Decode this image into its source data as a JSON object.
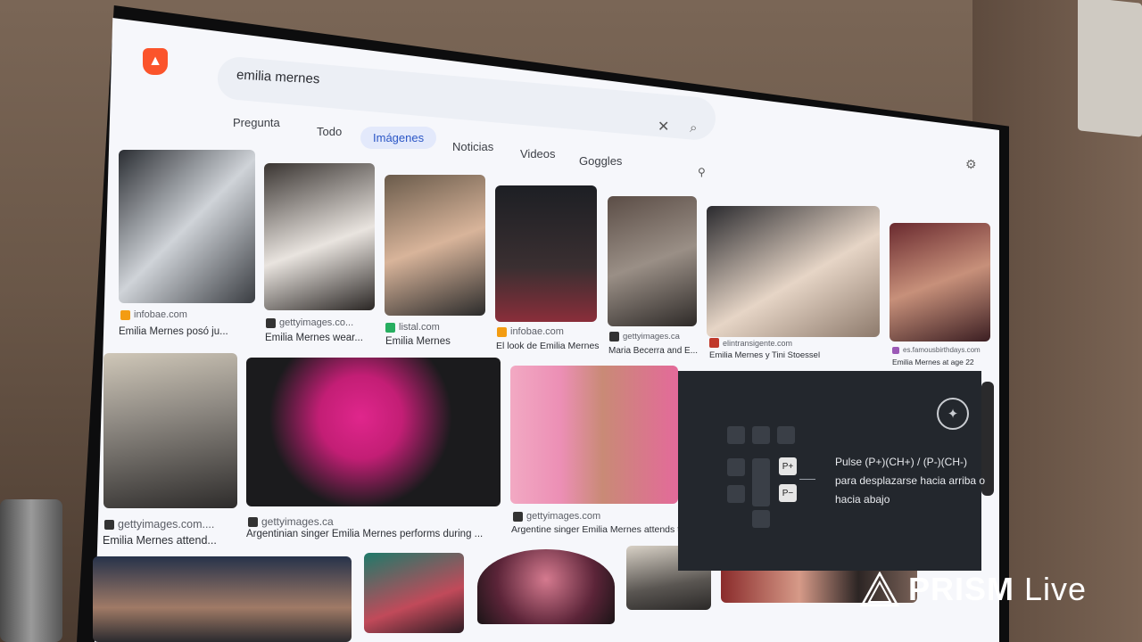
{
  "browser": {
    "search_query": "emilia mernes"
  },
  "tabs": [
    {
      "label": "Pregunta",
      "active": false
    },
    {
      "label": "Todo",
      "active": false
    },
    {
      "label": "Imágenes",
      "active": true
    },
    {
      "label": "Noticias",
      "active": false
    },
    {
      "label": "Videos",
      "active": false
    },
    {
      "label": "Goggles",
      "active": false
    }
  ],
  "results": [
    {
      "source": "infobae.com",
      "title": "Emilia Mernes posó ju...",
      "fav": "#f39c12"
    },
    {
      "source": "gettyimages.co...",
      "title": "Emilia Mernes wear...",
      "fav": "#333333"
    },
    {
      "source": "listal.com",
      "title": "Emilia Mernes",
      "fav": "#27ae60"
    },
    {
      "source": "infobae.com",
      "title": "El look de Emilia Mernes",
      "fav": "#f39c12"
    },
    {
      "source": "gettyimages.ca",
      "title": "Maria Becerra and E...",
      "fav": "#333333"
    },
    {
      "source": "elintransigente.com",
      "title": "Emilia Mernes y Tini Stoessel",
      "fav": "#c0392b"
    },
    {
      "source": "es.famousbirthdays.com",
      "title": "Emilia Mernes at age 22",
      "fav": "#9b59b6"
    },
    {
      "source": "gettyimages.com....",
      "title": "Emilia Mernes attend...",
      "fav": "#333333"
    },
    {
      "source": "gettyimages.ca",
      "title": "Argentinian singer Emilia Mernes performs during ...",
      "fav": "#333333"
    },
    {
      "source": "gettyimages.com",
      "title": "Argentine singer Emilia Mernes attends th",
      "fav": "#333333"
    }
  ],
  "tv_overlay": {
    "plus_label": "P+",
    "minus_label": "P−",
    "hint": "Pulse (P+)(CH+) / (P-)(CH-) para desplazarse hacia arriba o hacia abajo"
  },
  "watermark": {
    "brand": "PRISM",
    "suffix": "Live"
  },
  "colors": {
    "accent": "#2b56c6",
    "brave_orange": "#fb542b",
    "overlay_bg": "#23272d"
  }
}
